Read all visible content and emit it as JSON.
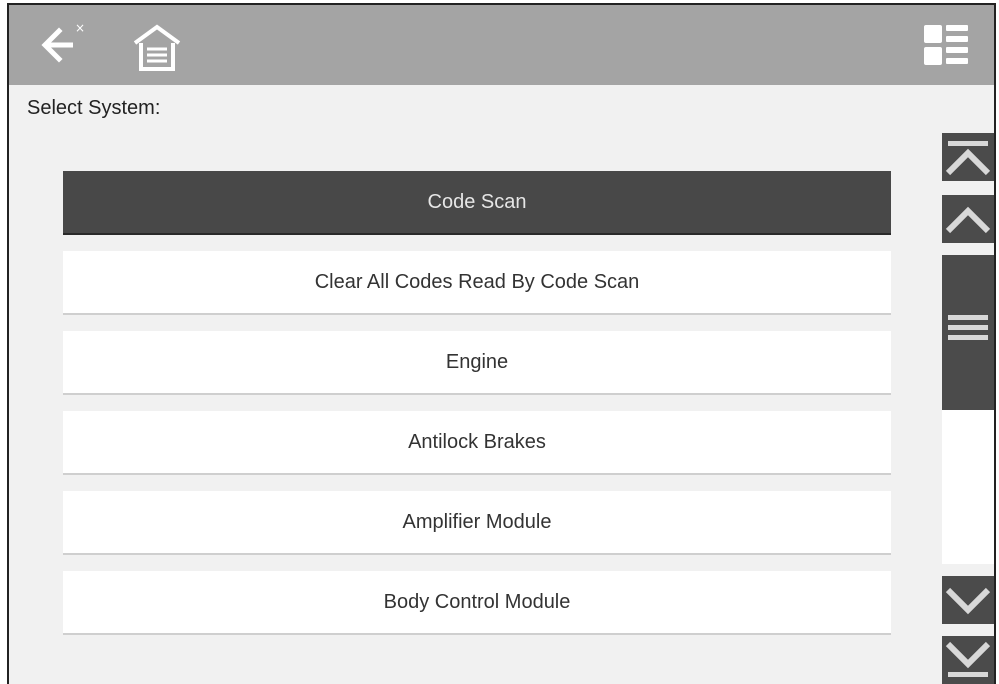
{
  "toolbar": {
    "back_icon": "back-arrow-icon",
    "home_icon": "home-icon",
    "menu_icon": "view-menu-icon",
    "bar_color": "#a4a4a4"
  },
  "main": {
    "prompt": "Select System:",
    "selected_index": 0,
    "items": [
      {
        "label": "Code Scan"
      },
      {
        "label": "Clear All Codes Read By Code Scan"
      },
      {
        "label": "Engine"
      },
      {
        "label": "Antilock Brakes"
      },
      {
        "label": "Amplifier Module"
      },
      {
        "label": "Body Control Module"
      }
    ]
  },
  "scrollbar": {
    "icons": [
      "scroll-to-top-icon",
      "scroll-up-icon",
      "scroll-thumb-grip-icon",
      "scroll-down-icon",
      "scroll-to-bottom-icon"
    ],
    "accent": "#4b4b4b"
  }
}
